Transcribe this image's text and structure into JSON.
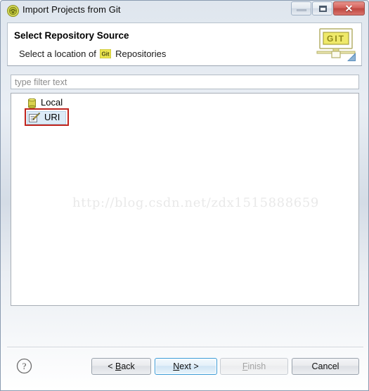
{
  "window": {
    "title": "Import Projects from Git",
    "icon": "eclipse-git-icon",
    "controls": {
      "minimize_label": "Minimize",
      "maximize_label": "Maximize",
      "close_label": "✕"
    }
  },
  "banner": {
    "title": "Select Repository Source",
    "subtitle_before": "Select a location of",
    "subtitle_after": "Repositories",
    "inline_icon": "git-badge-icon",
    "icon": "git-monitor-banner-icon"
  },
  "filter": {
    "value": "",
    "placeholder": "type filter text"
  },
  "tree": {
    "items": [
      {
        "label": "Local",
        "icon": "database-cylinder-icon",
        "selected": false
      },
      {
        "label": "URI",
        "icon": "edit-pencil-icon",
        "selected": true
      }
    ]
  },
  "annotation": {
    "target": "URI",
    "color": "#c0241d"
  },
  "watermark": {
    "text": "http://blog.csdn.net/zdx1515888659"
  },
  "footer": {
    "help_label": "?",
    "buttons": [
      {
        "name": "back",
        "prefix": "< ",
        "mnemonic": "B",
        "suffix": "ack",
        "enabled": true,
        "focused": false
      },
      {
        "name": "next",
        "prefix": "",
        "mnemonic": "N",
        "suffix": "ext >",
        "enabled": true,
        "focused": true
      },
      {
        "name": "finish",
        "prefix": "",
        "mnemonic": "F",
        "suffix": "inish",
        "enabled": false,
        "focused": false
      },
      {
        "name": "cancel",
        "prefix": "",
        "mnemonic": "",
        "suffix": "Cancel",
        "enabled": true,
        "focused": false
      }
    ]
  },
  "colors": {
    "accent": "#3c9bd6",
    "selection": "#dcebf7",
    "annotation": "#c0241d",
    "git_yellow": "#e8e04a"
  }
}
